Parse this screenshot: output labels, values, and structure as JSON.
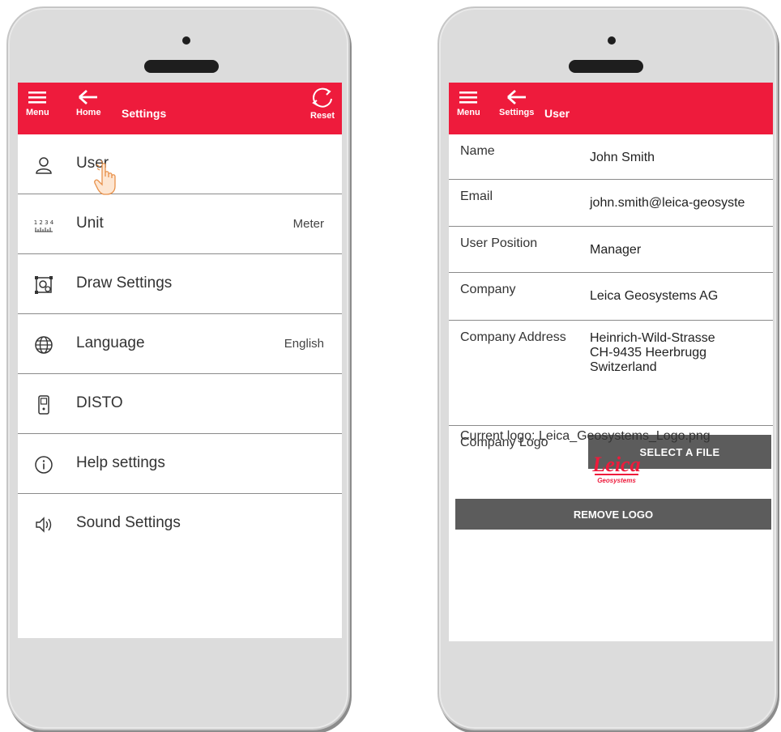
{
  "left": {
    "appbar": {
      "menu_label": "Menu",
      "back_label": "Home",
      "title": "Settings",
      "reset_label": "Reset"
    },
    "items": [
      {
        "label": "User",
        "value": ""
      },
      {
        "label": "Unit",
        "value": "Meter"
      },
      {
        "label": "Draw Settings",
        "value": ""
      },
      {
        "label": "Language",
        "value": "English"
      },
      {
        "label": "DISTO",
        "value": ""
      },
      {
        "label": "Help settings",
        "value": ""
      },
      {
        "label": "Sound Settings",
        "value": ""
      }
    ],
    "unit_icon_text": "1 2 3 4"
  },
  "right": {
    "appbar": {
      "menu_label": "Menu",
      "back_label": "Settings",
      "title": "User"
    },
    "fields": {
      "name": {
        "label": "Name",
        "value": "John Smith"
      },
      "email": {
        "label": "Email",
        "value": "john.smith@leica-geosyste"
      },
      "position": {
        "label": "User Position",
        "value": "Manager"
      },
      "company": {
        "label": "Company",
        "value": "Leica Geosystems AG"
      },
      "address": {
        "label": "Company Address",
        "value": "Heinrich-Wild-Strasse\nCH-9435  Heerbrugg\nSwitzerland"
      },
      "logo": {
        "label": "Company Logo",
        "button": "SELECT A FILE"
      }
    },
    "current_logo": "Current logo: Leica_Geosystems_Logo.png",
    "logo_text": {
      "brand": "Leica",
      "sub": "Geosystems"
    },
    "remove_button": "REMOVE LOGO"
  },
  "colors": {
    "accent": "#ee1b3c",
    "button": "#5c5c5c"
  }
}
